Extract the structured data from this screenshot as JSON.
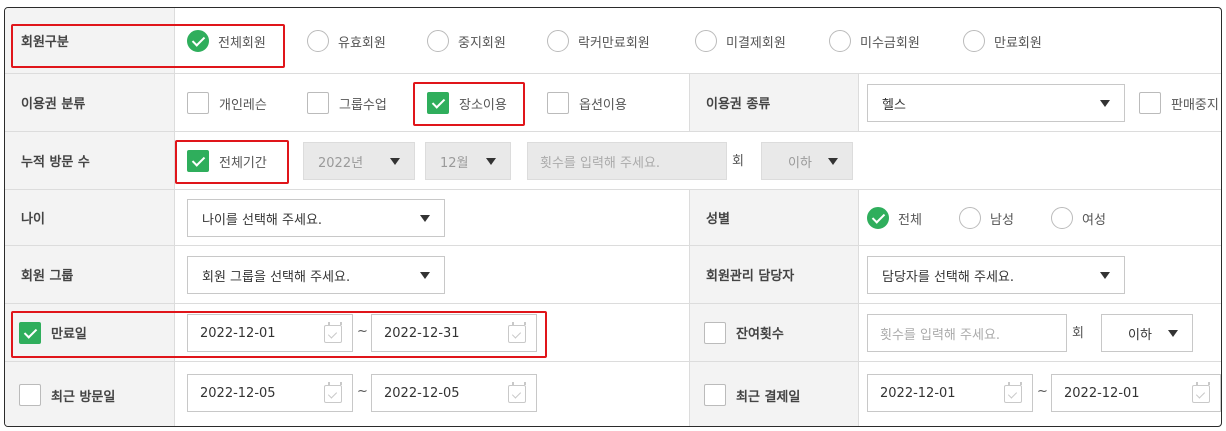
{
  "member_type": {
    "label": "회원구분",
    "options": [
      "전체회원",
      "유효회원",
      "중지회원",
      "락커만료회원",
      "미결제회원",
      "미수금회원",
      "만료회원"
    ],
    "selected": "전체회원"
  },
  "ticket_category": {
    "label": "이용권 분류",
    "options": [
      "개인레슨",
      "그룹수업",
      "장소이용",
      "옵션이용"
    ],
    "checked": "장소이용"
  },
  "ticket_type": {
    "label": "이용권 종류",
    "value": "헬스",
    "sale_stop_label": "판매중지"
  },
  "visits": {
    "label": "누적 방문 수",
    "all_period_label": "전체기간",
    "year": "2022년",
    "month": "12월",
    "count_placeholder": "횟수를 입력해 주세요.",
    "unit": "회",
    "compare": "이하"
  },
  "age": {
    "label": "나이",
    "placeholder": "나이를 선택해 주세요."
  },
  "gender": {
    "label": "성별",
    "options": [
      "전체",
      "남성",
      "여성"
    ],
    "selected": "전체"
  },
  "member_group": {
    "label": "회원 그룹",
    "placeholder": "회원 그룹을 선택해 주세요."
  },
  "manager": {
    "label": "회원관리 담당자",
    "placeholder": "담당자를 선택해 주세요."
  },
  "expiry": {
    "label": "만료일",
    "from": "2022-12-01",
    "to": "2022-12-31",
    "tilde": "~"
  },
  "remaining": {
    "label": "잔여횟수",
    "placeholder": "횟수를 입력해 주세요.",
    "unit": "회",
    "compare": "이하"
  },
  "recent_visit": {
    "label": "최근 방문일",
    "from": "2022-12-05",
    "to": "2022-12-05",
    "tilde": "~"
  },
  "recent_payment": {
    "label": "최근 결제일",
    "from": "2022-12-01",
    "to": "2022-12-01",
    "tilde": "~"
  },
  "colors": {
    "accent": "#2fae5c",
    "highlight": "#e0151a",
    "label_bg": "#f3f3f3"
  }
}
